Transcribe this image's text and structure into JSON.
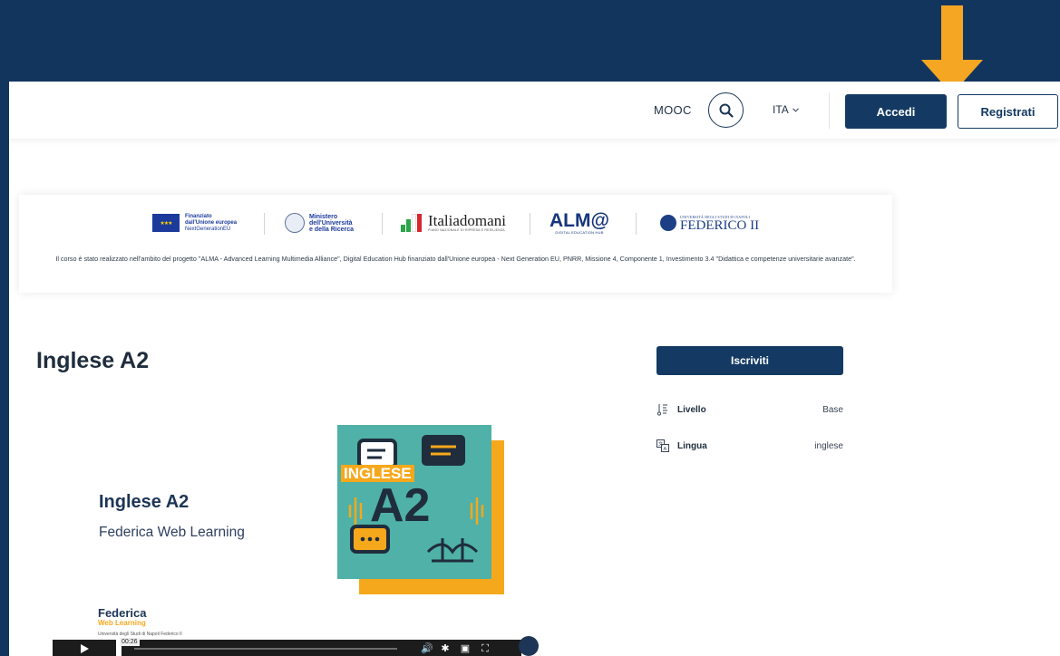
{
  "header": {
    "mooc_label": "MOOC",
    "language_label": "ITA",
    "login_label": "Accedi",
    "register_label": "Registrati"
  },
  "banner": {
    "logos": {
      "eu_line1": "Finanziato",
      "eu_line2": "dall'Unione europea",
      "eu_line3": "NextGenerationEU",
      "mur_line1": "Ministero",
      "mur_line2": "dell'Università",
      "mur_line3": "e della Ricerca",
      "italia_main": "Italiadomani",
      "italia_sub": "PIANO NAZIONALE DI RIPRESA E RESILIENZA",
      "alma_main": "ALM@",
      "alma_sub": "DIGITAL EDUCATION HUB",
      "federico_sub": "UNIVERSITÀ DEGLI STUDI DI NAPOLI",
      "federico_main": "FEDERICO II"
    },
    "text": "Il corso è stato realizzato nell'ambito del progetto \"ALMA - Advanced Learning Multimedia Alliance\", Digital Education Hub finanziato dall'Unione europea - Next Generation EU, PNRR, Missione 4, Componente 1, Investimento 3.4 \"Didattica e competenze universitarie avanzate\"."
  },
  "course": {
    "title": "Inglese A2",
    "enroll_label": "Iscriviti",
    "level_label": "Livello",
    "level_value": "Base",
    "language_label": "Lingua",
    "language_value": "inglese"
  },
  "video": {
    "title": "Inglese A2",
    "subtitle": "Federica Web Learning",
    "thumb_tag": "INGLESE",
    "thumb_big": "A2",
    "logo_main": "Federica",
    "logo_sub": "Web Learning",
    "logo_caption": "Università degli Studi di Napoli Federico II",
    "time": "00:26"
  },
  "colors": {
    "brand_navy": "#143a63",
    "outer_bg": "#12355e",
    "arrow": "#f5a623",
    "thumb_teal": "#4fb1a7",
    "thumb_orange": "#f6a81c"
  },
  "icons": [
    "arrow-down-icon",
    "search-icon",
    "chevron-down-icon",
    "level-icon",
    "language-icon",
    "play-icon",
    "volume-icon",
    "settings-icon",
    "pip-icon",
    "fullscreen-icon"
  ]
}
